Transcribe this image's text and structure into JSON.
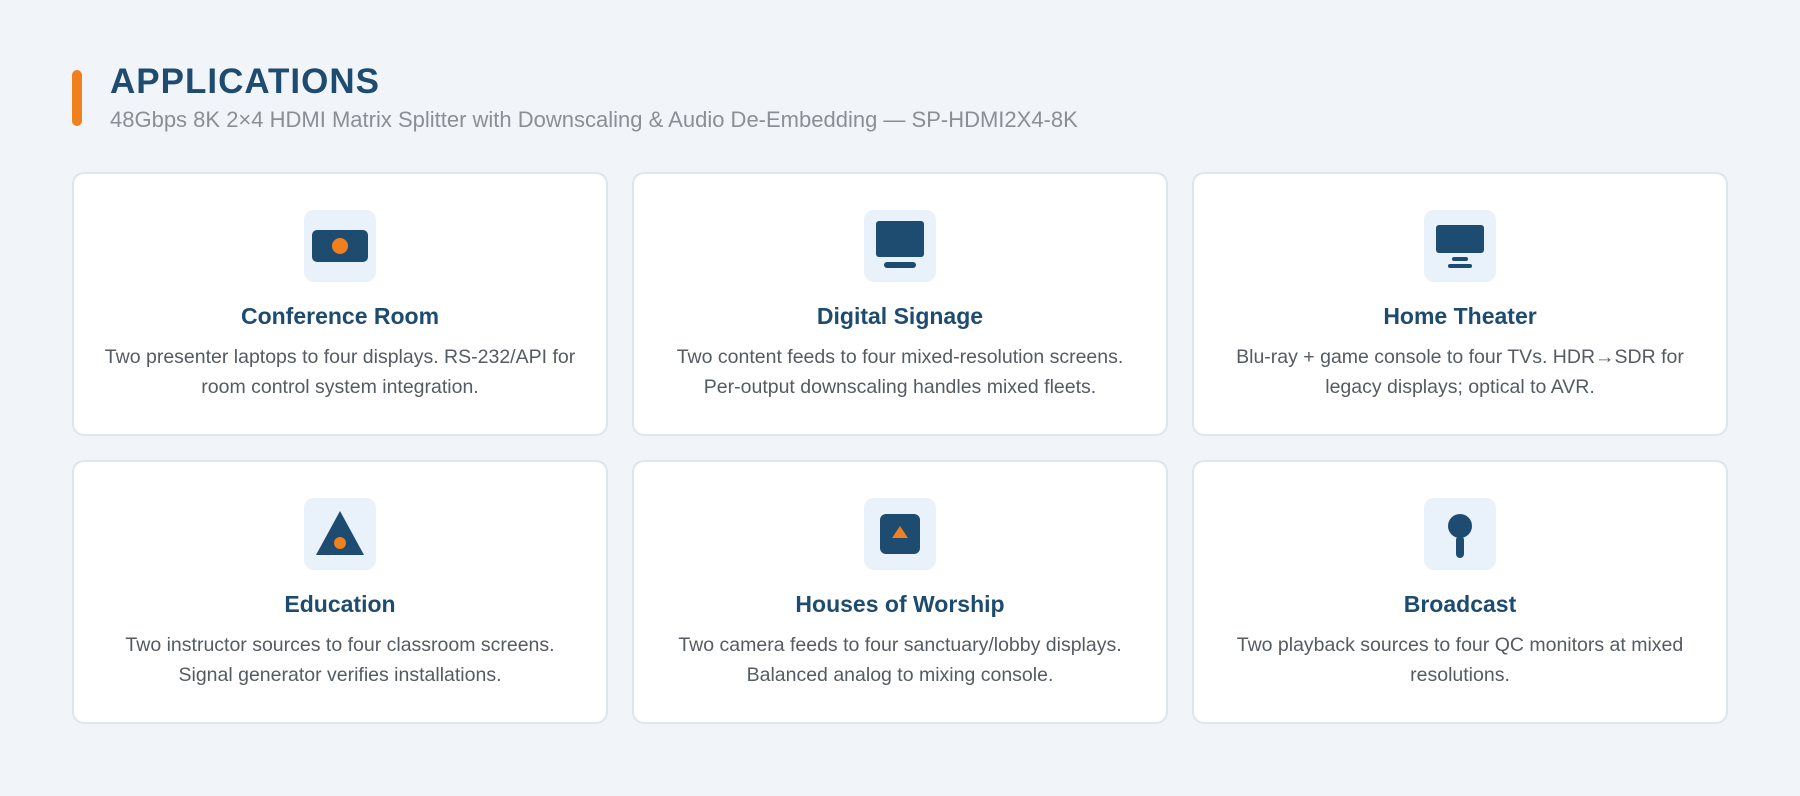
{
  "header": {
    "title": "APPLICATIONS",
    "subtitle": "48Gbps 8K 2×4 HDMI Matrix Splitter with Downscaling & Audio De-Embedding — SP-HDMI2X4-8K"
  },
  "colors": {
    "accent": "#f0801e",
    "navy": "#1e4b70",
    "icon_bg": "#e9f1fb",
    "page_bg": "#f1f5f9"
  },
  "cards": [
    {
      "icon": "projector-icon",
      "title": "Conference Room",
      "description": "Two presenter laptops to four displays. RS-232/API for room control system integration."
    },
    {
      "icon": "monitor-icon",
      "title": "Digital Signage",
      "description": "Two content feeds to four mixed-resolution screens. Per-output downscaling handles mixed fleets."
    },
    {
      "icon": "tv-icon",
      "title": "Home Theater",
      "description": "Blu-ray + game console to four TVs. HDR→SDR for legacy displays; optical to AVR."
    },
    {
      "icon": "education-icon",
      "title": "Education",
      "description": "Two instructor sources to four classroom screens. Signal generator verifies installations."
    },
    {
      "icon": "worship-icon",
      "title": "Houses of Worship",
      "description": "Two camera feeds to four sanctuary/lobby displays. Balanced analog to mixing console."
    },
    {
      "icon": "microphone-icon",
      "title": "Broadcast",
      "description": "Two playback sources to four QC monitors at mixed resolutions."
    }
  ]
}
